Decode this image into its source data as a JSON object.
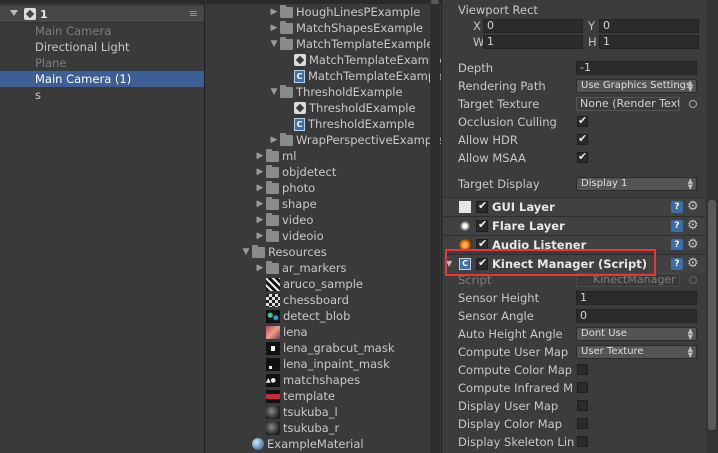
{
  "hierarchy": {
    "scene_name": "1",
    "menu_glyph": "≡",
    "items": [
      {
        "label": "Main Camera",
        "state": "dim"
      },
      {
        "label": "Directional Light",
        "state": "normal"
      },
      {
        "label": "Plane",
        "state": "dim"
      },
      {
        "label": "Main Camera (1)",
        "state": "selected"
      },
      {
        "label": "s",
        "state": "normal"
      }
    ]
  },
  "project": {
    "items": [
      {
        "label": "HoughLinesPExample",
        "icon": "folder-icon",
        "arrow": "▶"
      },
      {
        "label": "MatchShapesExample",
        "icon": "folder-icon",
        "arrow": "▶"
      },
      {
        "label": "MatchTemplateExample",
        "icon": "folder-icon",
        "arrow": "▼"
      },
      {
        "label": "MatchTemplateExample",
        "icon": "unity-scene-icon",
        "arrow": ""
      },
      {
        "label": "MatchTemplateExample",
        "icon": "csharp-script-icon",
        "arrow": ""
      },
      {
        "label": "ThresholdExample",
        "icon": "folder-icon",
        "arrow": "▼"
      },
      {
        "label": "ThresholdExample",
        "icon": "unity-scene-icon",
        "arrow": ""
      },
      {
        "label": "ThresholdExample",
        "icon": "csharp-script-icon",
        "arrow": ""
      },
      {
        "label": "WrapPerspectiveExample",
        "icon": "folder-icon",
        "arrow": "▶"
      },
      {
        "label": "ml",
        "icon": "folder-icon",
        "arrow": "▶"
      },
      {
        "label": "objdetect",
        "icon": "folder-icon",
        "arrow": "▶"
      },
      {
        "label": "photo",
        "icon": "folder-icon",
        "arrow": "▶"
      },
      {
        "label": "shape",
        "icon": "folder-icon",
        "arrow": "▶"
      },
      {
        "label": "video",
        "icon": "folder-icon",
        "arrow": "▶"
      },
      {
        "label": "videoio",
        "icon": "folder-icon",
        "arrow": "▶"
      },
      {
        "label": "Resources",
        "icon": "folder-icon",
        "arrow": "▼"
      },
      {
        "label": "ar_markers",
        "icon": "folder-icon",
        "arrow": "▶"
      },
      {
        "label": "aruco_sample",
        "icon": "texture-aruco-icon",
        "arrow": ""
      },
      {
        "label": "chessboard",
        "icon": "texture-chessboard-icon",
        "arrow": ""
      },
      {
        "label": "detect_blob",
        "icon": "texture-blob-icon",
        "arrow": ""
      },
      {
        "label": "lena",
        "icon": "texture-lena-icon",
        "arrow": ""
      },
      {
        "label": "lena_grabcut_mask",
        "icon": "texture-mask-icon",
        "arrow": ""
      },
      {
        "label": "lena_inpaint_mask",
        "icon": "texture-inpaint-icon",
        "arrow": ""
      },
      {
        "label": "matchshapes",
        "icon": "texture-shapes-icon",
        "arrow": ""
      },
      {
        "label": "template",
        "icon": "texture-template-icon",
        "arrow": ""
      },
      {
        "label": "tsukuba_l",
        "icon": "texture-tsukuba-icon",
        "arrow": ""
      },
      {
        "label": "tsukuba_r",
        "icon": "texture-tsukuba-icon",
        "arrow": ""
      },
      {
        "label": "ExampleMaterial",
        "icon": "material-sphere-icon",
        "arrow": ""
      }
    ]
  },
  "inspector": {
    "viewport_rect_label": "Viewport Rect",
    "x_label": "X",
    "x_value": "0",
    "y_label": "Y",
    "y_value": "0",
    "w_label": "W",
    "w_value": "1",
    "h_label": "H",
    "h_value": "1",
    "depth_label": "Depth",
    "depth_value": "-1",
    "rendering_path_label": "Rendering Path",
    "rendering_path_value": "Use Graphics Settings",
    "target_texture_label": "Target Texture",
    "target_texture_value": "None (Render Texture)",
    "occlusion_label": "Occlusion Culling",
    "occlusion_checked": true,
    "allow_hdr_label": "Allow HDR",
    "allow_hdr_checked": true,
    "allow_msaa_label": "Allow MSAA",
    "allow_msaa_checked": true,
    "target_display_label": "Target Display",
    "target_display_value": "Display 1",
    "components": [
      {
        "title": "GUI Layer",
        "icon": "gui-layer-icon"
      },
      {
        "title": "Flare Layer",
        "icon": "flare-layer-icon"
      },
      {
        "title": "Audio Listener",
        "icon": "audio-listener-icon"
      },
      {
        "title": "Kinect Manager (Script)",
        "icon": "csharp-script-icon"
      }
    ],
    "script_label": "Script",
    "script_value": "KinectManager",
    "sensor_height_label": "Sensor Height",
    "sensor_height_value": "1",
    "sensor_angle_label": "Sensor Angle",
    "sensor_angle_value": "0",
    "auto_height_label": "Auto Height Angle",
    "auto_height_value": "Dont Use",
    "compute_user_map_label": "Compute User Map",
    "compute_user_map_value": "User Texture",
    "compute_color_map_label": "Compute Color Map",
    "compute_infrared_label": "Compute Infrared M",
    "display_user_map_label": "Display User Map",
    "display_color_map_label": "Display Color Map",
    "display_skeleton_label": "Display Skeleton Lin"
  },
  "colors": {
    "selection": "#3e5f96",
    "highlight_box": "#e23a3a",
    "panel_bg": "#3a3a3a"
  }
}
